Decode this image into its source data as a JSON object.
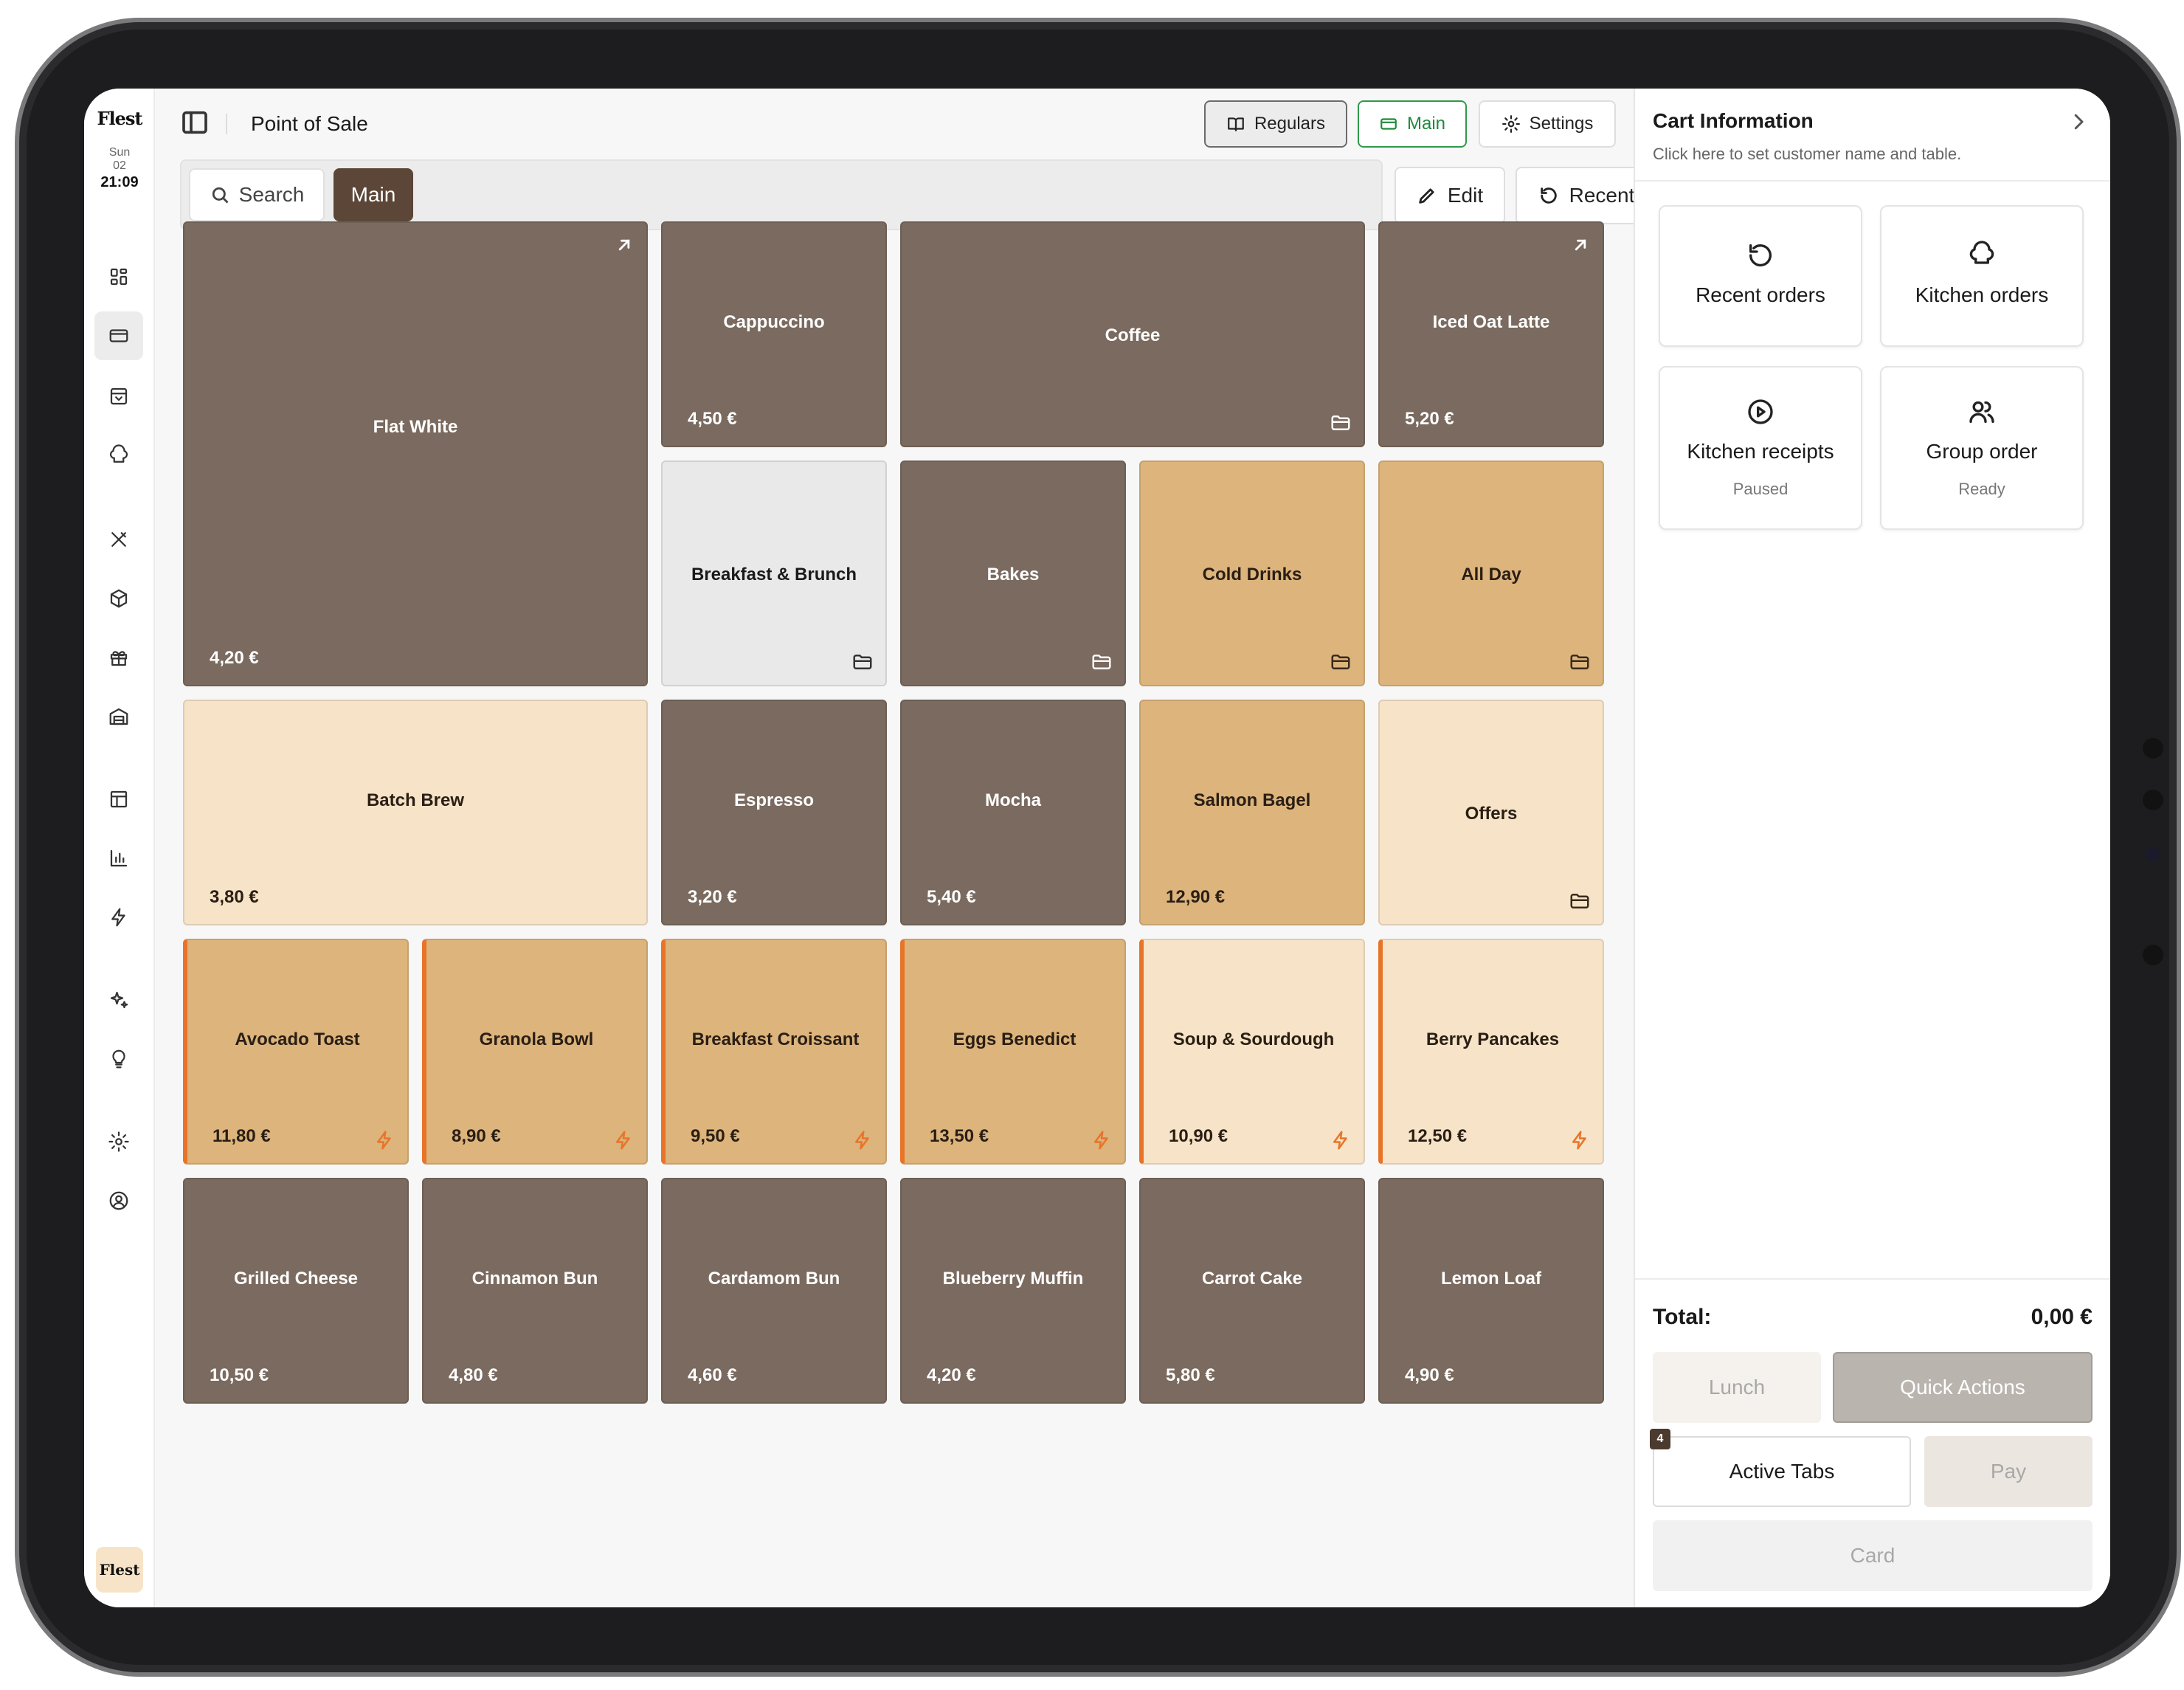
{
  "brand": "Flest",
  "clock": {
    "day": "Sun",
    "date": "02",
    "time": "21:09"
  },
  "header": {
    "title": "Point of Sale",
    "regulars_label": "Regulars",
    "main_label": "Main",
    "settings_label": "Settings"
  },
  "toolbar": {
    "search_label": "Search",
    "active_category": "Main",
    "edit_label": "Edit",
    "recents_label": "Recents"
  },
  "rail": {
    "icons": [
      "dashboard-icon",
      "pos-card-icon",
      "inbox-icon",
      "chef-hat-icon",
      "utensils-icon",
      "package-icon",
      "gift-icon",
      "warehouse-icon",
      "table-icon",
      "bar-chart-icon",
      "lightning-icon",
      "sparkles-icon",
      "lightbulb-icon",
      "gear-icon",
      "user-circle-icon"
    ],
    "active": "pos-card-icon",
    "logo_label": "Flest"
  },
  "tiles": [
    {
      "name": "Flat White",
      "price": "4,20 €",
      "style": "brown",
      "icon": "open-arrow-icon"
    },
    {
      "name": "Cappuccino",
      "price": "4,50 €",
      "style": "brown"
    },
    {
      "name": "Coffee",
      "price": "",
      "style": "brown",
      "icon": "folder-icon"
    },
    {
      "name": "Iced Oat Latte",
      "price": "5,20 €",
      "style": "brown",
      "icon": "open-arrow-icon"
    },
    {
      "name": "Breakfast & Brunch",
      "price": "",
      "style": "light",
      "icon": "folder-icon"
    },
    {
      "name": "Bakes",
      "price": "",
      "style": "brown",
      "icon": "folder-icon"
    },
    {
      "name": "Cold Drinks",
      "price": "",
      "style": "tan",
      "icon": "folder-icon"
    },
    {
      "name": "All Day",
      "price": "",
      "style": "tan",
      "icon": "folder-icon"
    },
    {
      "name": "Batch Brew",
      "price": "3,80 €",
      "style": "cream"
    },
    {
      "name": "Espresso",
      "price": "3,20 €",
      "style": "brown"
    },
    {
      "name": "Mocha",
      "price": "5,40 €",
      "style": "brown"
    },
    {
      "name": "Salmon Bagel",
      "price": "12,90 €",
      "style": "tan"
    },
    {
      "name": "Offers",
      "price": "",
      "style": "cream",
      "icon": "folder-icon"
    },
    {
      "name": "Avocado Toast",
      "price": "11,80 €",
      "style": "tan",
      "icon": "bolt-icon"
    },
    {
      "name": "Granola Bowl",
      "price": "8,90 €",
      "style": "tan",
      "icon": "bolt-icon"
    },
    {
      "name": "Breakfast Croissant",
      "price": "9,50 €",
      "style": "tan",
      "icon": "bolt-icon"
    },
    {
      "name": "Eggs Benedict",
      "price": "13,50 €",
      "style": "tan",
      "icon": "bolt-icon"
    },
    {
      "name": "Soup & Sourdough",
      "price": "10,90 €",
      "style": "cream",
      "icon": "bolt-icon"
    },
    {
      "name": "Berry Pancakes",
      "price": "12,50 €",
      "style": "cream",
      "icon": "bolt-icon"
    },
    {
      "name": "Grilled Cheese",
      "price": "10,50 €",
      "style": "brown"
    },
    {
      "name": "Cinnamon Bun",
      "price": "4,80 €",
      "style": "brown"
    },
    {
      "name": "Cardamom Bun",
      "price": "4,60 €",
      "style": "brown"
    },
    {
      "name": "Blueberry Muffin",
      "price": "4,20 €",
      "style": "brown"
    },
    {
      "name": "Carrot Cake",
      "price": "5,80 €",
      "style": "brown"
    },
    {
      "name": "Lemon Loaf",
      "price": "4,90 €",
      "style": "brown"
    }
  ],
  "cart": {
    "title": "Cart Information",
    "subtitle": "Click here to set customer name and table.",
    "quick_cards": [
      {
        "label": "Recent orders",
        "status": "",
        "icon": "rotate-ccw-icon"
      },
      {
        "label": "Kitchen orders",
        "status": "",
        "icon": "chef-hat-icon"
      },
      {
        "label": "Kitchen receipts",
        "status": "Paused",
        "icon": "play-circle-icon"
      },
      {
        "label": "Group order",
        "status": "Ready",
        "icon": "users-icon"
      }
    ],
    "total_label": "Total:",
    "total_value": "0,00 €",
    "lunch_label": "Lunch",
    "quick_actions_label": "Quick Actions",
    "active_tabs_label": "Active Tabs",
    "active_tabs_count": "4",
    "pay_label": "Pay",
    "card_label": "Card"
  },
  "colors": {
    "tile_brown": "#7a6a5f",
    "tile_tan": "#dcb47c",
    "tile_cream": "#f7e4c8",
    "tile_light": "#e9e9e9",
    "accent_orange": "#e8742a",
    "main_green": "#1f8a3b",
    "chip_brown": "#5b4638"
  }
}
